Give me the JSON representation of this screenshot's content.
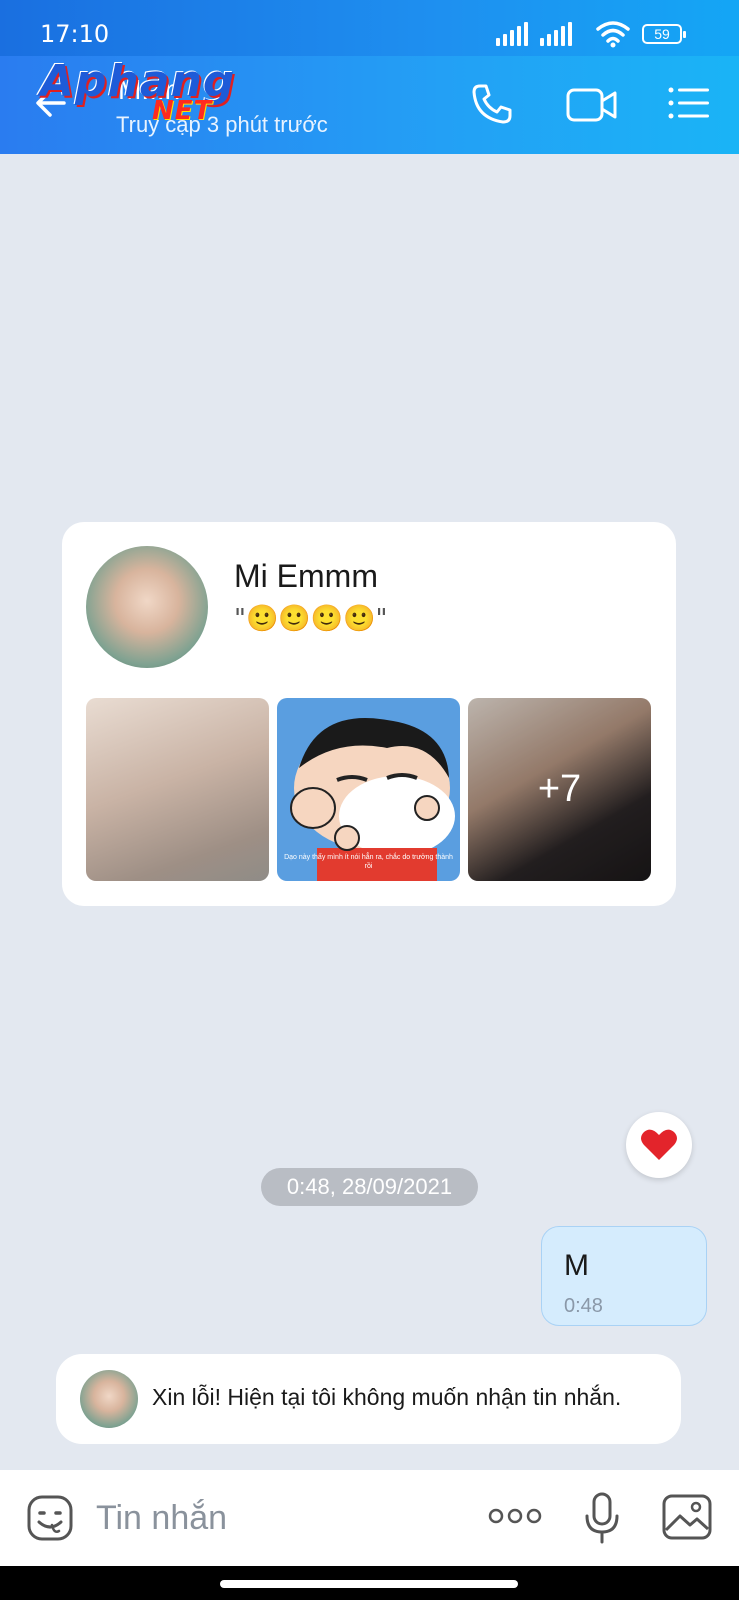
{
  "status_bar": {
    "time": "17:10",
    "battery": "59"
  },
  "header": {
    "contact_name": "M...n",
    "last_seen": "Truy cập 3 phút trước",
    "watermark_top": "Aphang",
    "watermark_bottom": "NET",
    "icons": [
      "back-arrow-icon",
      "phone-icon",
      "video-call-icon",
      "menu-icon"
    ]
  },
  "profile_card": {
    "name": "Mi Emmm",
    "status": "\"🙂🙂🙂🙂\"",
    "more_photos": "+7",
    "cartoon_caption": "Dạo này thấy mình ít nói hẳn ra, chắc do trưởng thành rồi"
  },
  "reaction": {
    "icon": "heart-icon",
    "color": "#e3242b"
  },
  "timestamp": "0:48, 28/09/2021",
  "outgoing_message": {
    "text": "M",
    "time": "0:48"
  },
  "auto_reply": {
    "text": "Xin lỗi! Hiện tại tôi không muốn nhận tin nhắn."
  },
  "input_bar": {
    "placeholder": "Tin nhắn",
    "icons": [
      "sticker-icon",
      "more-options-icon",
      "microphone-icon",
      "gallery-icon"
    ]
  },
  "colors": {
    "header_gradient_start": "#2a7cf0",
    "header_gradient_end": "#1ab4f6",
    "chat_background": "#e3e8f0",
    "outgoing_bubble": "#d5ecfd"
  }
}
